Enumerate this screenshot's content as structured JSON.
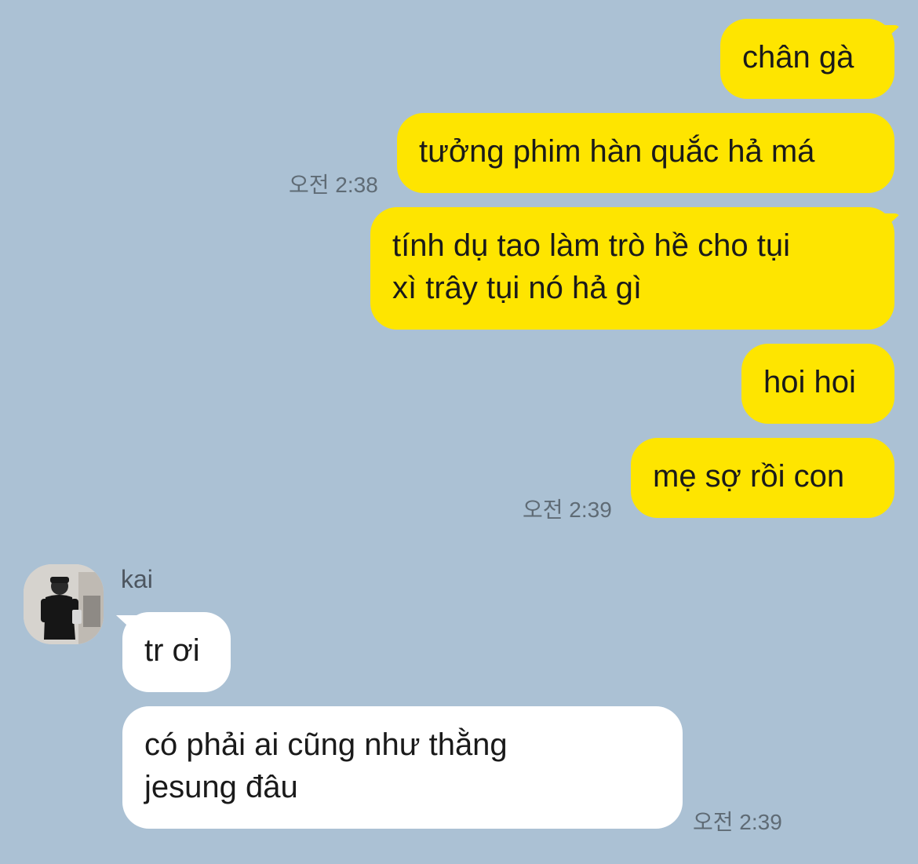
{
  "messages": {
    "m1": "chân gà",
    "m2": "tưởng phim hàn quắc hả má",
    "m3_line1": "tính dụ tao làm trò hề cho tụi",
    "m3_line2": "xì trây tụi nó hả gì",
    "m4": "hoi hoi",
    "m5": "mẹ sợ rồi con",
    "r1": "tr ơi",
    "r2_line1": "có phải ai cũng như thằng",
    "r2_line2": "jesung đâu"
  },
  "times": {
    "t1": "오전 2:38",
    "t2": "오전 2:39",
    "t3": "오전 2:39"
  },
  "sender": {
    "name": "kai",
    "avatar_icon": "profile-photo"
  },
  "colors": {
    "background": "#abc1d4",
    "outgoing_bubble": "#fee500",
    "incoming_bubble": "#ffffff"
  }
}
